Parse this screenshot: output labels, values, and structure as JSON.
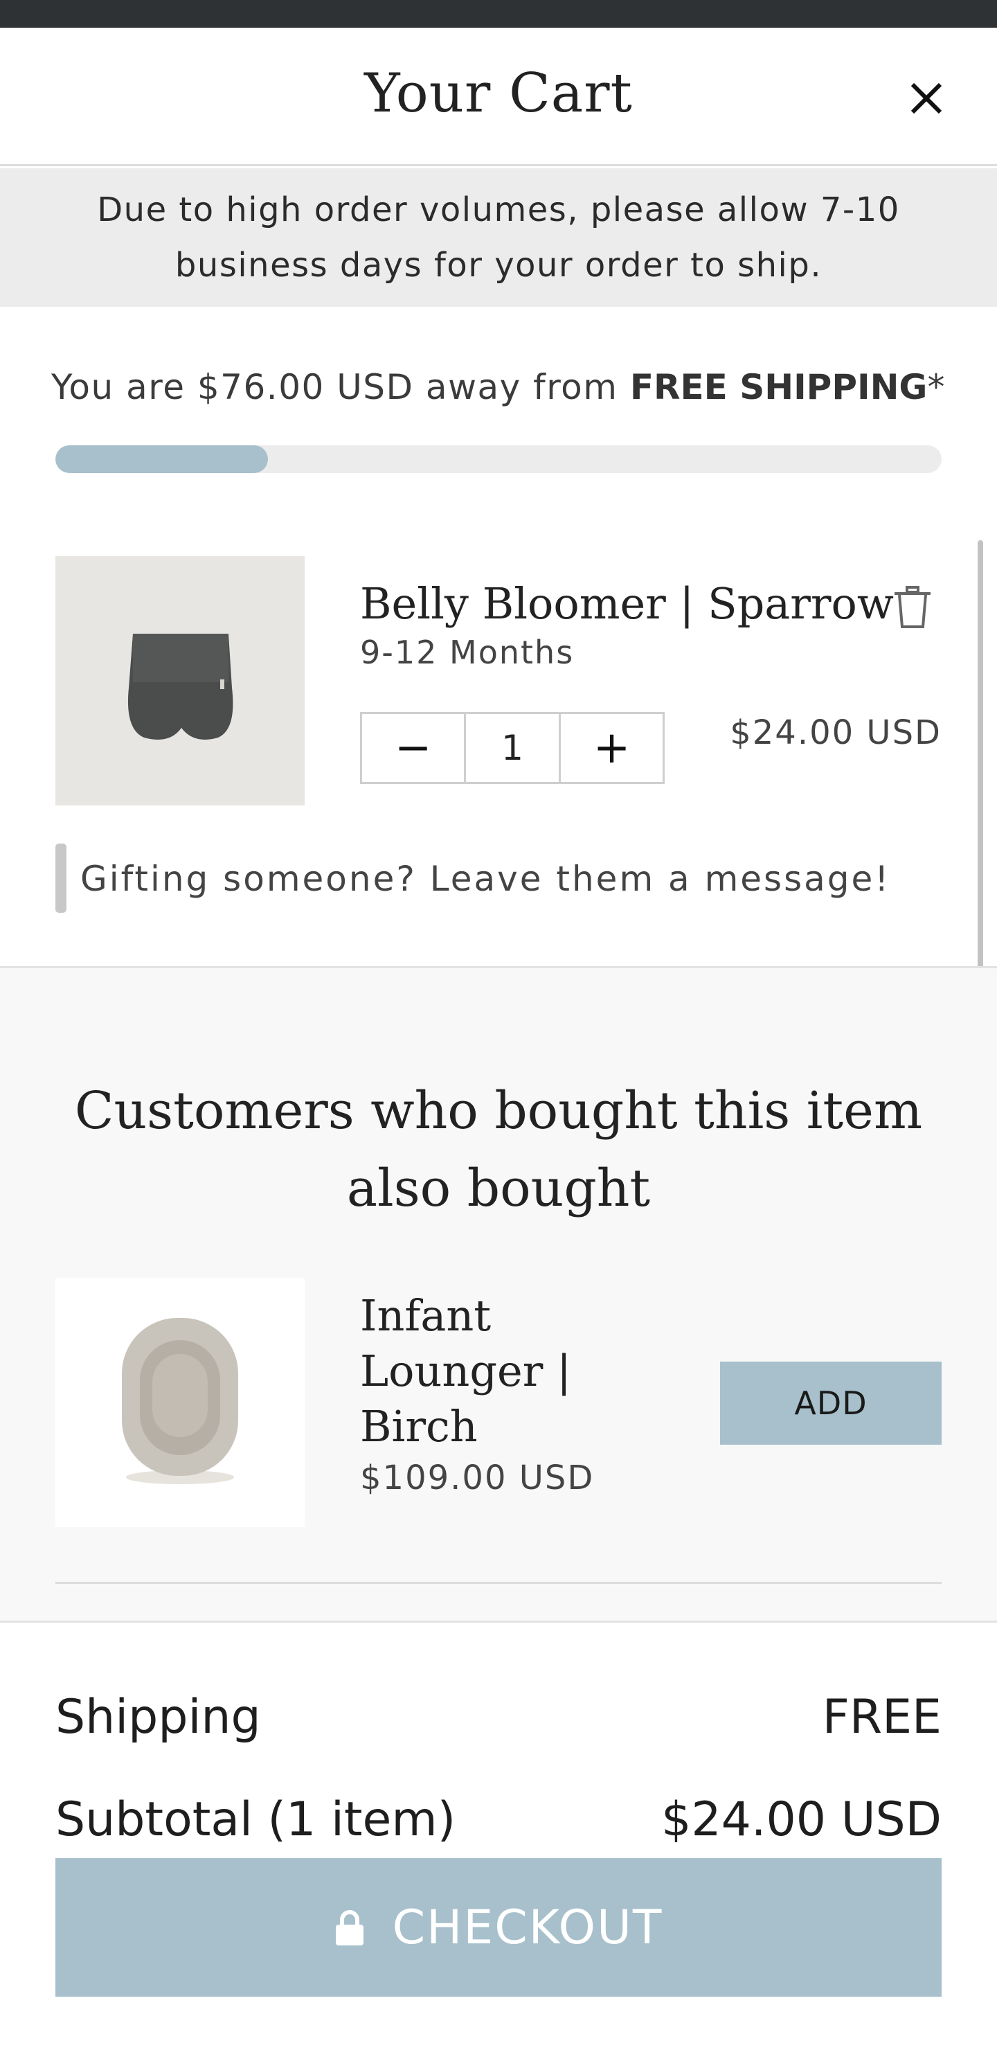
{
  "cart": {
    "title": "Your Cart",
    "notice": "Due to high order volumes, please allow 7-10 business days for your order to ship.",
    "free_shipping": {
      "prefix": "You are $76.00 USD away from ",
      "emphasis": "FREE SHIPPING",
      "suffix": "*",
      "progress_fraction": 0.24
    },
    "item": {
      "name": "Belly Bloomer | Sparrow",
      "variant": "9-12 Months",
      "quantity": "1",
      "price": "$24.00 USD",
      "minus": "−",
      "plus": "+"
    },
    "gift_placeholder": "Gifting someone? Leave them a message!"
  },
  "upsell": {
    "heading": "Customers who bought this item also bought",
    "product": {
      "name": "Infant Lounger | Birch",
      "price": "$109.00 USD",
      "add_label": "ADD"
    }
  },
  "summary": {
    "shipping_label": "Shipping",
    "shipping_value": "FREE",
    "subtotal_label": "Subtotal (1 item)",
    "subtotal_value": "$24.00 USD",
    "checkout_label": "CHECKOUT"
  },
  "colors": {
    "accent": "#a7c0cc",
    "status_bar": "#2e3234",
    "notice_bg": "#ececec"
  },
  "icons": {
    "close": "close-icon",
    "trash": "trash-icon",
    "lock": "lock-icon"
  }
}
